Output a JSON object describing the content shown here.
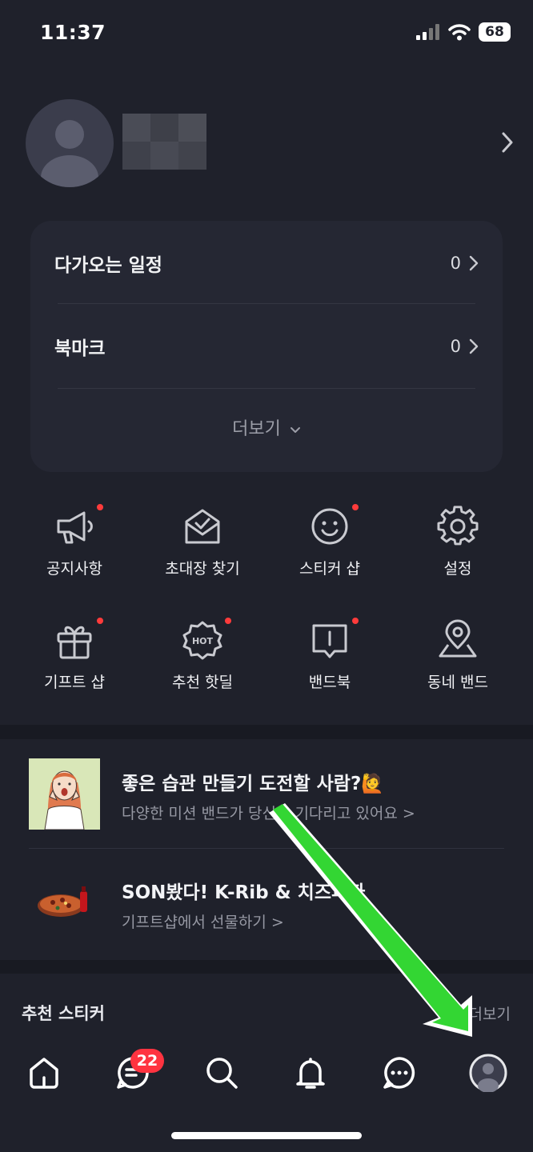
{
  "status_bar": {
    "time": "11:37",
    "battery": "68",
    "icons": [
      "signal-icon",
      "wifi-icon",
      "battery-icon"
    ]
  },
  "profile": {
    "chevron_icon": "chevron-right-icon"
  },
  "summary_card": {
    "rows": [
      {
        "label": "다가오는 일정",
        "count": "0"
      },
      {
        "label": "북마크",
        "count": "0"
      }
    ],
    "more_label": "더보기",
    "more_icon": "chevron-down-icon"
  },
  "menu": {
    "items": [
      {
        "label": "공지사항",
        "icon": "megaphone-icon",
        "new": true
      },
      {
        "label": "초대장 찾기",
        "icon": "envelope-check-icon",
        "new": false
      },
      {
        "label": "스티커 샵",
        "icon": "smiley-icon",
        "new": true
      },
      {
        "label": "설정",
        "icon": "gear-icon",
        "new": false
      },
      {
        "label": "기프트 샵",
        "icon": "gift-icon",
        "new": true
      },
      {
        "label": "추천 핫딜",
        "icon": "hot-badge-icon",
        "icon_text": "HOT",
        "new": true
      },
      {
        "label": "밴드북",
        "icon": "book-icon",
        "new": true
      },
      {
        "label": "동네 밴드",
        "icon": "location-pin-icon",
        "new": false
      }
    ]
  },
  "promos": [
    {
      "title": "좋은 습관 만들기 도전할 사람?🙋",
      "subtitle": "다양한 미션 밴드가 당신을 기다리고 있어요 >",
      "thumb": "excited-woman-illustration"
    },
    {
      "title": "SON봤다! K-Rib & 치즈피자",
      "subtitle": "기프트샵에서 선물하기 >",
      "thumb": "pizza-image"
    }
  ],
  "recommended_stickers": {
    "title": "추천 스티커",
    "more_label": "더보기"
  },
  "tab_bar": {
    "tabs": [
      {
        "name": "home",
        "icon": "home-icon"
      },
      {
        "name": "feed",
        "icon": "feed-icon",
        "badge": "22"
      },
      {
        "name": "search",
        "icon": "search-icon"
      },
      {
        "name": "notifications",
        "icon": "bell-icon"
      },
      {
        "name": "chat",
        "icon": "chat-bubble-icon"
      },
      {
        "name": "profile",
        "icon": "profile-avatar-icon",
        "selected": true
      }
    ]
  },
  "colors": {
    "background": "#1f212b",
    "card": "#252733",
    "separator": "#181a22",
    "dot": "#ff3b3b",
    "badge": "#ff3340",
    "annotation_arrow": "#33d633"
  }
}
